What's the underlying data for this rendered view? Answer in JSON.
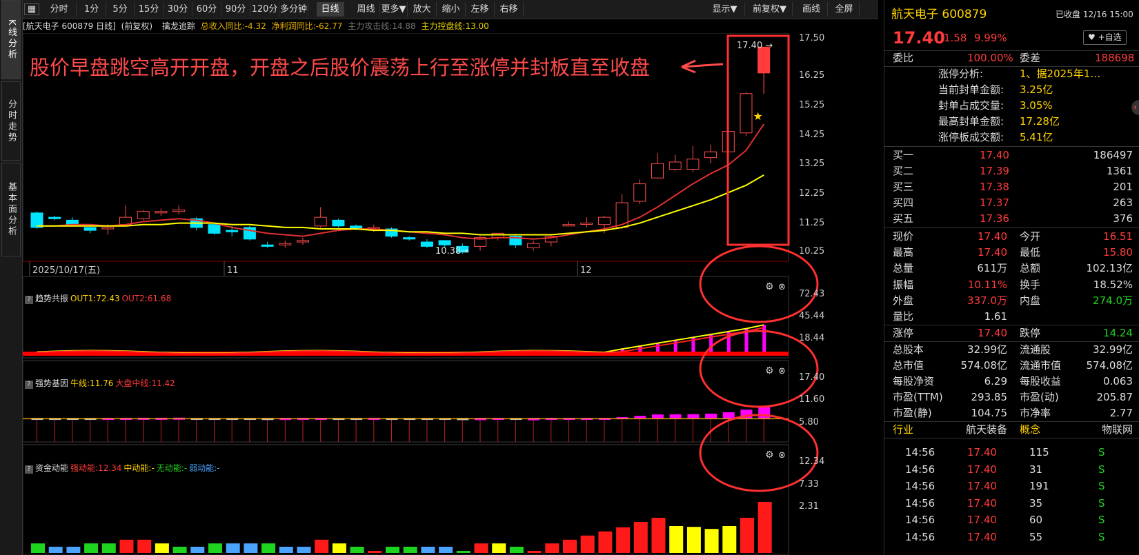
{
  "sidebar": {
    "tabs": [
      "K线分析",
      "分时走势",
      "基本面分析"
    ]
  },
  "toolbar": {
    "buttons": [
      "分时",
      "1分",
      "5分",
      "15分",
      "30分",
      "60分",
      "90分",
      "120分",
      "多分钟",
      "日线",
      "周线",
      "更多▼",
      "放大",
      "缩小",
      "左移",
      "右移",
      "显示▼",
      "前复权▼",
      "画线",
      "全屏"
    ],
    "active": "日线"
  },
  "info": {
    "stock": "[航天电子 600879 日线]",
    "adj": "(前复权)",
    "indicator": "擒龙追踪",
    "rev": "总收入同比:-4.32",
    "profit": "净利润同比:-62.77",
    "attack": "主力攻击线:14.88",
    "control": "主力控盘线:13.00"
  },
  "annotation": {
    "text": "股价早盘跳空高开开盘，开盘之后股价震荡上行至涨停并封板直至收盘",
    "high_label": "17.40",
    "low_label": "10.38"
  },
  "price_axis": [
    "17.50",
    "16.25",
    "15.25",
    "14.25",
    "13.25",
    "12.25",
    "11.25",
    "10.25"
  ],
  "date_axis": {
    "d1": "2025/10/17(五)",
    "d2": "11",
    "d3": "12"
  },
  "p2": {
    "name": "趋势共振",
    "o1": "OUT1:72.43",
    "o2": "OUT2:61.68",
    "ticks": [
      "72.43",
      "45.44",
      "18.44"
    ]
  },
  "p3": {
    "name": "强势基因",
    "a": "牛线:11.76",
    "b": "大盘中线:11.42",
    "ticks": [
      "17.40",
      "11.60",
      "5.80"
    ]
  },
  "p4": {
    "name": "资金动能",
    "a": "强动能:12.34",
    "b": "中动能:-",
    "c": "无动能:-",
    "d": "弱动能:-",
    "ticks": [
      "12.34",
      "7.33",
      "2.31"
    ]
  },
  "chart_data": {
    "type": "candlestick",
    "candles": [
      [
        11.7,
        11.2,
        11.75,
        11.15
      ],
      [
        11.55,
        11.5,
        11.6,
        11.45
      ],
      [
        11.45,
        11.3,
        11.55,
        11.25
      ],
      [
        11.2,
        11.1,
        11.3,
        11.0
      ],
      [
        11.15,
        11.2,
        11.3,
        10.95
      ],
      [
        11.3,
        11.55,
        11.95,
        11.25
      ],
      [
        11.5,
        11.75,
        11.8,
        11.45
      ],
      [
        11.7,
        11.75,
        11.85,
        11.6
      ],
      [
        11.75,
        11.8,
        11.95,
        11.65
      ],
      [
        11.5,
        11.2,
        11.55,
        11.1
      ],
      [
        11.3,
        11.0,
        11.35,
        10.95
      ],
      [
        11.1,
        11.05,
        11.25,
        10.9
      ],
      [
        11.2,
        10.8,
        11.25,
        10.75
      ],
      [
        10.6,
        10.55,
        10.7,
        10.5
      ],
      [
        10.6,
        10.65,
        10.75,
        10.5
      ],
      [
        10.7,
        10.75,
        10.85,
        10.6
      ],
      [
        11.25,
        11.55,
        11.9,
        11.2
      ],
      [
        11.45,
        11.25,
        11.5,
        11.2
      ],
      [
        11.25,
        11.15,
        11.3,
        11.1
      ],
      [
        11.2,
        11.2,
        11.3,
        11.05
      ],
      [
        11.15,
        10.9,
        11.2,
        10.85
      ],
      [
        10.85,
        10.8,
        10.9,
        10.75
      ],
      [
        10.7,
        10.55,
        10.8,
        10.5
      ],
      [
        10.75,
        10.6,
        10.75,
        10.5
      ],
      [
        10.55,
        10.35,
        10.65,
        10.3
      ],
      [
        10.55,
        10.85,
        10.9,
        10.4
      ],
      [
        10.85,
        11.0,
        11.0,
        10.75
      ],
      [
        10.9,
        10.6,
        10.95,
        10.5
      ],
      [
        10.5,
        10.65,
        10.75,
        10.4
      ],
      [
        10.7,
        10.9,
        10.95,
        10.55
      ],
      [
        11.25,
        11.3,
        11.4,
        11.25
      ],
      [
        11.35,
        11.35,
        11.55,
        11.2
      ],
      [
        11.3,
        11.55,
        11.6,
        11.0
      ],
      [
        11.2,
        12.05,
        12.35,
        11.15
      ],
      [
        12.1,
        12.7,
        12.85,
        12.0
      ],
      [
        12.9,
        13.4,
        13.75,
        12.9
      ],
      [
        13.2,
        13.45,
        13.7,
        13.15
      ],
      [
        13.2,
        13.55,
        14.0,
        13.1
      ],
      [
        13.6,
        13.8,
        14.05,
        13.4
      ],
      [
        13.8,
        14.5,
        14.75,
        13.6
      ],
      [
        14.45,
        15.8,
        15.85,
        14.35
      ],
      [
        16.51,
        17.4,
        17.4,
        15.8
      ]
    ],
    "ma_fast": [
      11.25,
      11.25,
      11.3,
      11.3,
      11.25,
      11.3,
      11.4,
      11.45,
      11.5,
      11.45,
      11.35,
      11.2,
      11.1,
      11.0,
      10.95,
      10.9,
      11.0,
      11.1,
      11.15,
      11.15,
      11.1,
      11.05,
      11.0,
      10.95,
      10.85,
      10.8,
      10.85,
      10.85,
      10.8,
      10.85,
      10.95,
      11.05,
      11.15,
      11.3,
      11.55,
      11.9,
      12.3,
      12.7,
      13.05,
      13.35,
      13.85,
      14.75
    ],
    "ma_slow": [
      11.25,
      11.25,
      11.25,
      11.25,
      11.25,
      11.25,
      11.3,
      11.3,
      11.35,
      11.35,
      11.35,
      11.3,
      11.3,
      11.25,
      11.2,
      11.2,
      11.15,
      11.15,
      11.15,
      11.1,
      11.1,
      11.05,
      11.05,
      11.0,
      11.0,
      10.95,
      10.95,
      10.95,
      10.95,
      10.95,
      11.0,
      11.05,
      11.1,
      11.2,
      11.35,
      11.55,
      11.75,
      11.95,
      12.15,
      12.4,
      12.65,
      13.0
    ]
  },
  "quote": {
    "name": "航天电子 600879",
    "status": "已收盘 12/16 15:00",
    "price": "17.40",
    "chg": "1.58",
    "pct": "9.99%",
    "fav": "♥ +自选",
    "wb_l": "委比",
    "wb_v": "100.00%",
    "wc_l": "委差",
    "wc_v": "188698",
    "zt": [
      [
        "涨停分析:",
        "1、据2025年1…"
      ],
      [
        "当前封单金额:",
        "3.25亿"
      ],
      [
        "封单占成交量:",
        "3.05%"
      ],
      [
        "最高封单金额:",
        "17.28亿"
      ],
      [
        "涨停板成交额:",
        "5.41亿"
      ]
    ],
    "buys": [
      [
        "买一",
        "17.40",
        "186497"
      ],
      [
        "买二",
        "17.39",
        "1361"
      ],
      [
        "买三",
        "17.38",
        "201"
      ],
      [
        "买四",
        "17.37",
        "263"
      ],
      [
        "买五",
        "17.36",
        "376"
      ]
    ],
    "stats": [
      [
        "现价",
        "17.40",
        "今开",
        "16.51"
      ],
      [
        "最高",
        "17.40",
        "最低",
        "15.80"
      ],
      [
        "总量",
        "611万",
        "总额",
        "102.13亿"
      ],
      [
        "振幅",
        "10.11%",
        "换手",
        "18.52%"
      ],
      [
        "外盘",
        "337.0万",
        "内盘",
        "274.0万"
      ],
      [
        "量比",
        "1.61",
        "",
        ""
      ],
      [
        "涨停",
        "17.40",
        "跌停",
        "14.24"
      ],
      [
        "总股本",
        "32.99亿",
        "流通股",
        "32.99亿"
      ],
      [
        "总市值",
        "574.08亿",
        "流通市值",
        "574.08亿"
      ],
      [
        "每股净资",
        "6.29",
        "每股收益",
        "0.063"
      ],
      [
        "市盈(TTM)",
        "293.85",
        "市盈(动)",
        "205.87"
      ],
      [
        "市盈(静)",
        "104.75",
        "市净率",
        "2.77"
      ]
    ],
    "ind": [
      "行业",
      "航天装备",
      "概念",
      "物联网"
    ],
    "ticks": [
      [
        "14:56",
        "17.40",
        "115",
        "S"
      ],
      [
        "14:56",
        "17.40",
        "31",
        "S"
      ],
      [
        "14:56",
        "17.40",
        "191",
        "S"
      ],
      [
        "14:56",
        "17.40",
        "35",
        "S"
      ],
      [
        "14:56",
        "17.40",
        "60",
        "S"
      ],
      [
        "14:56",
        "17.40",
        "55",
        "S"
      ]
    ]
  }
}
